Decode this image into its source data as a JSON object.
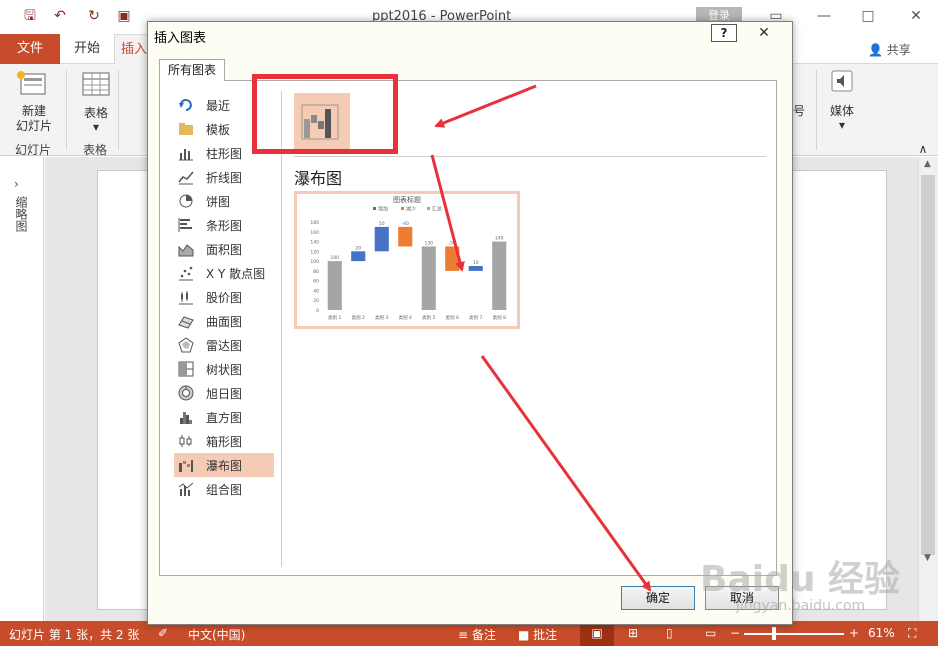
{
  "app": {
    "title": "ppt2016 - PowerPoint",
    "login": "登录",
    "share": "共享",
    "tabs": [
      "文件",
      "开始",
      "插入"
    ]
  },
  "ribbon": {
    "new_slide": "新建",
    "new_slide2": "幻灯片",
    "table": "表格",
    "group_slides": "幻灯片",
    "group_table": "表格",
    "media": "媒体",
    "partial": "号"
  },
  "thumbnail_label": "缩略图",
  "statusbar": {
    "slide_info": "幻灯片 第 1 张，共 2 张",
    "language": "中文(中国)",
    "notes": "备注",
    "comments": "批注",
    "zoom": "61%"
  },
  "dialog": {
    "title": "插入图表",
    "help": "?",
    "tab": "所有图表",
    "categories": [
      {
        "label": "最近",
        "icon": "recent-icon"
      },
      {
        "label": "模板",
        "icon": "folder-icon"
      },
      {
        "label": "柱形图",
        "icon": "column-chart-icon"
      },
      {
        "label": "折线图",
        "icon": "line-chart-icon"
      },
      {
        "label": "饼图",
        "icon": "pie-chart-icon"
      },
      {
        "label": "条形图",
        "icon": "bar-chart-icon"
      },
      {
        "label": "面积图",
        "icon": "area-chart-icon"
      },
      {
        "label": "X Y 散点图",
        "icon": "scatter-chart-icon"
      },
      {
        "label": "股价图",
        "icon": "stock-chart-icon"
      },
      {
        "label": "曲面图",
        "icon": "surface-chart-icon"
      },
      {
        "label": "雷达图",
        "icon": "radar-chart-icon"
      },
      {
        "label": "树状图",
        "icon": "treemap-chart-icon"
      },
      {
        "label": "旭日图",
        "icon": "sunburst-chart-icon"
      },
      {
        "label": "直方图",
        "icon": "histogram-chart-icon"
      },
      {
        "label": "箱形图",
        "icon": "box-chart-icon"
      },
      {
        "label": "瀑布图",
        "icon": "waterfall-chart-icon"
      },
      {
        "label": "组合图",
        "icon": "combo-chart-icon"
      }
    ],
    "selected_index": 15,
    "chart_type_name": "瀑布图",
    "ok": "确定",
    "cancel": "取消"
  },
  "chart_data": {
    "type": "bar",
    "title": "图表标题",
    "legend": [
      "增加",
      "减少",
      "汇总"
    ],
    "legend_position": "top",
    "categories": [
      "类别 1",
      "类别 2",
      "类别 3",
      "类别 4",
      "类别 5",
      "类别 6",
      "类别 7",
      "类别 8"
    ],
    "values": [
      100,
      20,
      50,
      -40,
      130,
      -50,
      10,
      140
    ],
    "data_labels": [
      "100",
      "20",
      "50",
      "-40",
      "130",
      "-50",
      "10",
      "140"
    ],
    "kinds": [
      "total",
      "increase",
      "increase",
      "decrease",
      "total",
      "decrease",
      "increase",
      "total"
    ],
    "colors": {
      "increase": "#4472c4",
      "decrease": "#ed7d31",
      "total": "#a5a5a5"
    },
    "ylim": [
      0,
      180
    ],
    "yticks": [
      0,
      20,
      40,
      60,
      80,
      100,
      120,
      140,
      160,
      180
    ]
  },
  "watermark": {
    "main": "Baidu 经验",
    "sub": "jingyan.baidu.com"
  },
  "colors": {
    "accent": "#c84c2b",
    "selection": "#f6cbb6",
    "annotation": "#e8313a"
  }
}
